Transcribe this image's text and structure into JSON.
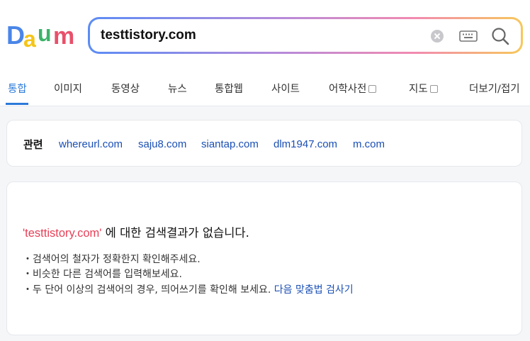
{
  "brand": {
    "logo_text": "Daum"
  },
  "search": {
    "query": "testtistory.com"
  },
  "tabs": [
    {
      "label": "통합",
      "active": true
    },
    {
      "label": "이미지"
    },
    {
      "label": "동영상"
    },
    {
      "label": "뉴스"
    },
    {
      "label": "통합웹"
    },
    {
      "label": "사이트"
    },
    {
      "label": "어학사전",
      "external": true
    },
    {
      "label": "지도",
      "external": true
    },
    {
      "label": "더보기/접기"
    }
  ],
  "related": {
    "label": "관련",
    "links": [
      "whereurl.com",
      "saju8.com",
      "siantap.com",
      "dlm1947.com",
      "m.com"
    ]
  },
  "no_result": {
    "query_quoted": "'testtistory.com'",
    "message_suffix": " 에 대한 검색결과가 없습니다.",
    "tips": [
      "검색어의 철자가 정확한지 확인해주세요.",
      "비슷한 다른 검색어를 입력해보세요.",
      "두 단어 이상의 검색어의 경우, 띄어쓰기를 확인해 보세요."
    ],
    "spellcheck_link": "다음 맞춤법 검사기"
  },
  "colors": {
    "accent": "#2b7ad9",
    "link": "#1a4fb5",
    "highlight": "#e84057"
  }
}
